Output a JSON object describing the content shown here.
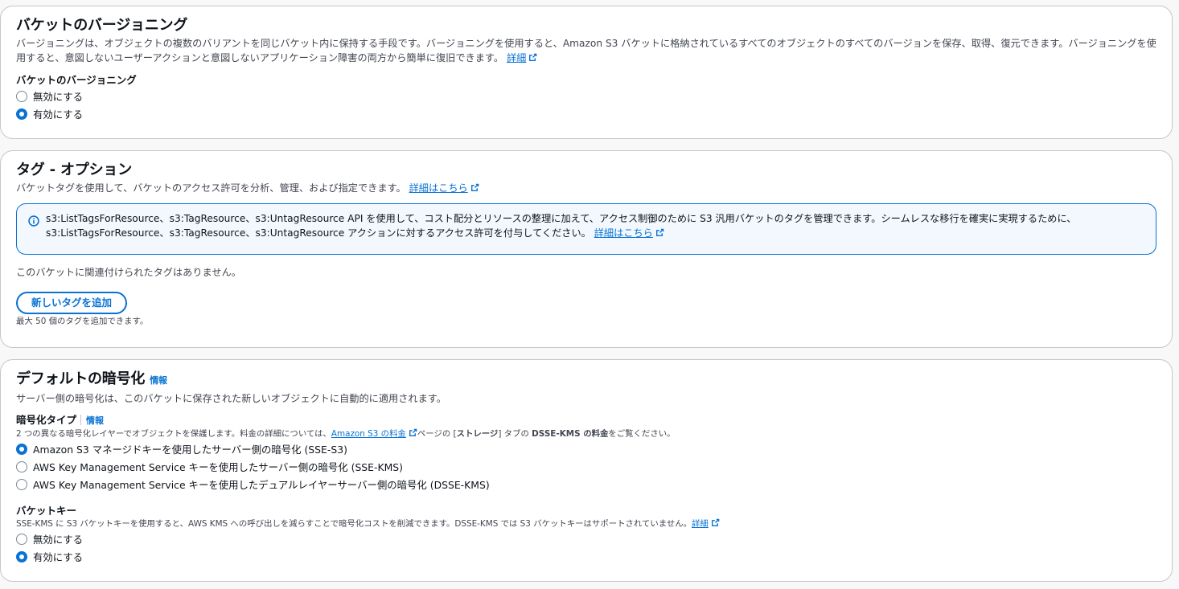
{
  "versioning": {
    "title": "バケットのバージョニング",
    "description": "バージョニングは、オブジェクトの複数のバリアントを同じバケット内に保持する手段です。バージョニングを使用すると、Amazon S3 バケットに格納されているすべてのオブジェクトのすべてのバージョンを保存、取得、復元できます。バージョニングを使用すると、意図しないユーザーアクションと意図しないアプリケーション障害の両方から簡単に復旧できます。",
    "learn_more": "詳細",
    "field_label": "バケットのバージョニング",
    "options": [
      {
        "label": "無効にする",
        "selected": false
      },
      {
        "label": "有効にする",
        "selected": true
      }
    ]
  },
  "tags": {
    "title": "タグ - オプション",
    "description": "バケットタグを使用して、バケットのアクセス許可を分析、管理、および指定できます。",
    "learn_more": "詳細はこちら",
    "alert_line1": "s3:ListTagsForResource、s3:TagResource、s3:UntagResource API を使用して、コスト配分とリソースの整理に加えて、アクセス制御のために S3 汎用バケットのタグを管理できます。シームレスな移行を確実に実現するために、",
    "alert_line2": "s3:ListTagsForResource、s3:TagResource、s3:UntagResource アクションに対するアクセス許可を付与してください。",
    "alert_link": "詳細はこちら",
    "empty_text": "このバケットに関連付けられたタグはありません。",
    "add_button": "新しいタグを追加",
    "limit_text": "最大 50 個のタグを追加できます。"
  },
  "encryption": {
    "title": "デフォルトの暗号化",
    "info": "情報",
    "description": "サーバー側の暗号化は、このバケットに保存された新しいオブジェクトに自動的に適用されます。",
    "type_label": "暗号化タイプ",
    "type_info": "情報",
    "type_desc_a": "2 つの異なる暗号化レイヤーでオブジェクトを保護します。料金の詳細については、",
    "type_desc_link": "Amazon S3 の料金",
    "type_desc_b": "ページの [",
    "type_desc_bold1": "ストレージ",
    "type_desc_c": "] タブの ",
    "type_desc_bold2": "DSSE-KMS の料金",
    "type_desc_d": "をご覧ください。",
    "options": [
      {
        "label": "Amazon S3 マネージドキーを使用したサーバー側の暗号化 (SSE-S3)",
        "selected": true
      },
      {
        "label": "AWS Key Management Service キーを使用したサーバー側の暗号化 (SSE-KMS)",
        "selected": false
      },
      {
        "label": "AWS Key Management Service キーを使用したデュアルレイヤーサーバー側の暗号化 (DSSE-KMS)",
        "selected": false
      }
    ],
    "bucket_key_label": "バケットキー",
    "bucket_key_desc": "SSE-KMS に S3 バケットキーを使用すると、AWS KMS への呼び出しを減らすことで暗号化コストを削減できます。DSSE-KMS では S3 バケットキーはサポートされていません。",
    "bucket_key_link": "詳細",
    "bucket_key_options": [
      {
        "label": "無効にする",
        "selected": false
      },
      {
        "label": "有効にする",
        "selected": true
      }
    ]
  }
}
